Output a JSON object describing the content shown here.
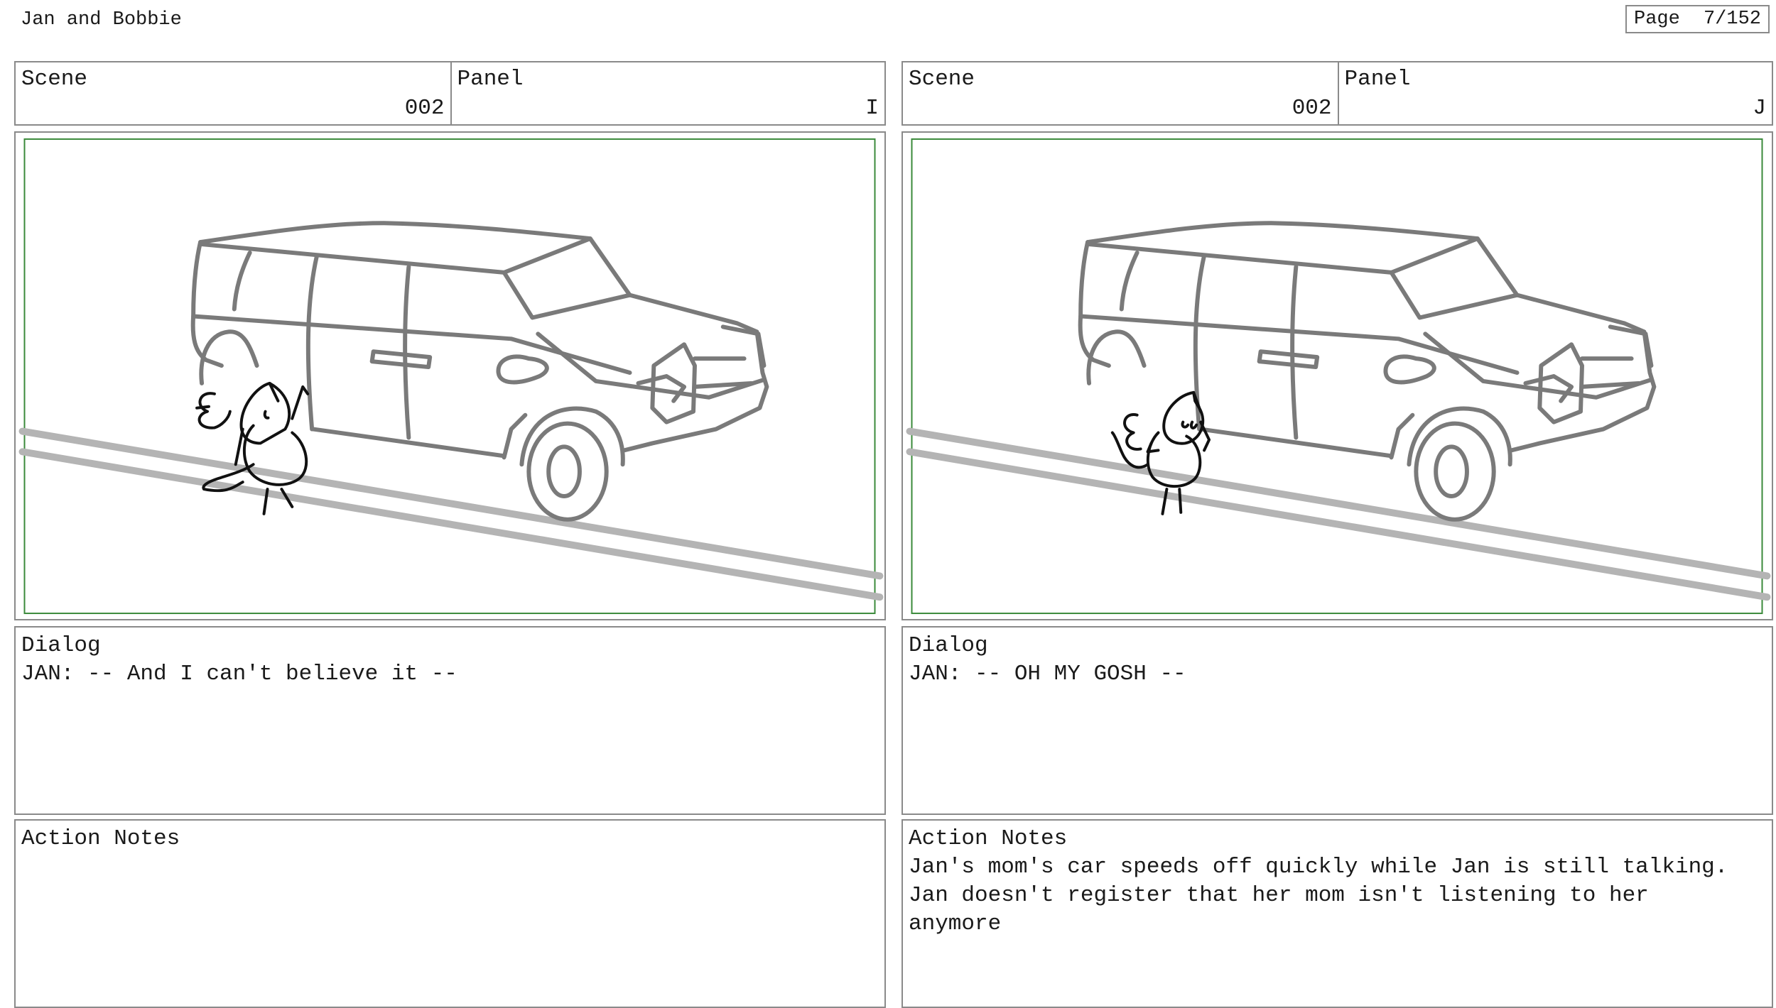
{
  "project_title": "Jan and Bobbie",
  "page": {
    "label": "Page",
    "number": "7/152"
  },
  "panels": [
    {
      "scene_label": "Scene",
      "scene": "002",
      "panel_label": "Panel",
      "panel": "I",
      "dialog_label": "Dialog",
      "dialog": "JAN: -- And I can't believe it --",
      "notes_label": "Action Notes",
      "notes": ""
    },
    {
      "scene_label": "Scene",
      "scene": "002",
      "panel_label": "Panel",
      "panel": "J",
      "dialog_label": "Dialog",
      "dialog": "JAN: -- OH MY GOSH --",
      "notes_label": "Action Notes",
      "notes": "Jan's mom's car speeds off quickly while Jan is still talking.\nJan doesn't register that her mom isn't listening to her\nanymore"
    }
  ],
  "colors": {
    "border": "#8a8a8a",
    "safe_frame": "#3a8a3a",
    "sketch_car": "#7a7a7a",
    "sketch_character": "#111111",
    "road_lines": "#b4b4b4"
  }
}
